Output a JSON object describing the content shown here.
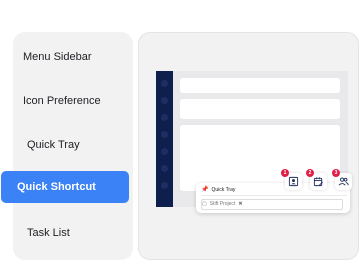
{
  "menu": {
    "items": [
      {
        "label": "Menu Sidebar"
      },
      {
        "label": "Icon Preference"
      },
      {
        "label": "Quick Tray"
      },
      {
        "label": "Quick Shortcut"
      },
      {
        "label": "Task List"
      }
    ],
    "active_index": 3
  },
  "preview": {
    "tray": {
      "row_label": "Quick Tray",
      "project_label": "Stift Project"
    },
    "badges": [
      "1",
      "2",
      "3"
    ],
    "icons": [
      "pin-icon",
      "person-card-icon",
      "calendar-edit-icon",
      "people-icon",
      "folder-icon",
      "close-icon"
    ]
  },
  "colors": {
    "accent": "#3b82f6",
    "sidebar_dark": "#0f1f4d",
    "badge": "#e11d48"
  }
}
